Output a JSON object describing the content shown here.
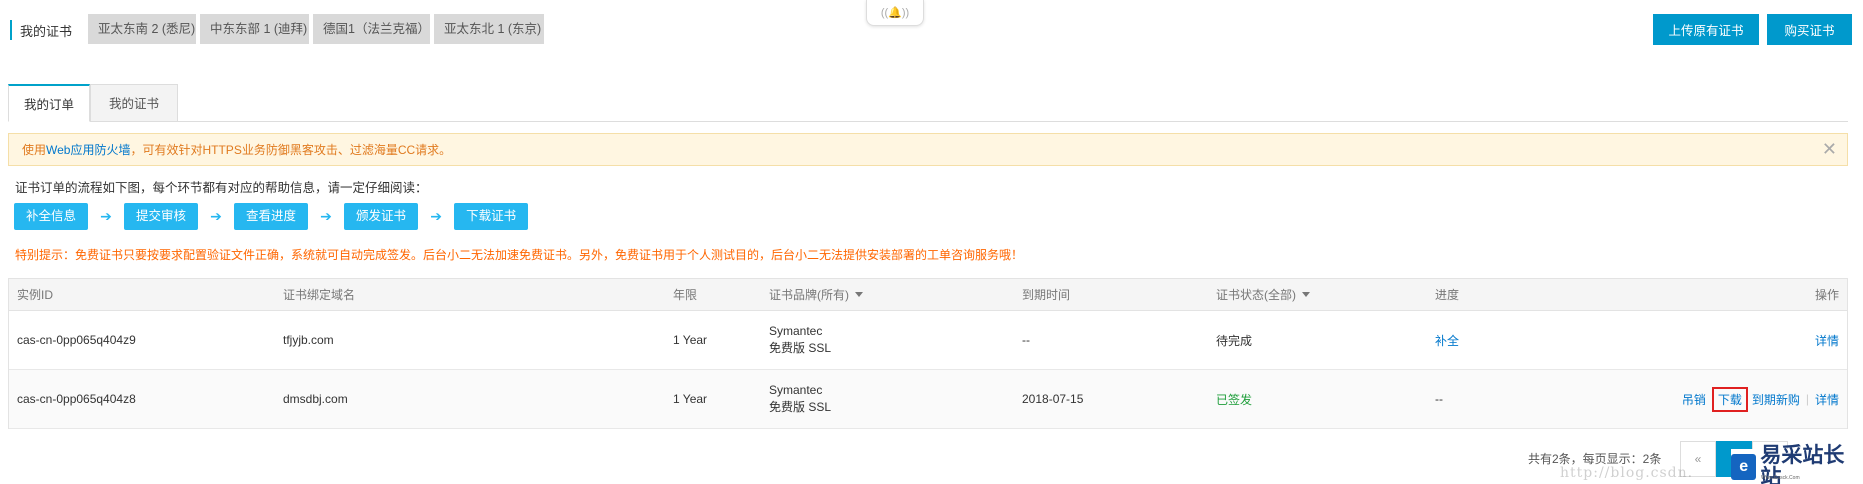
{
  "header": {
    "title": "我的证书",
    "regions": [
      "亚太东南 2 (悉尼)",
      "中东东部 1 (迪拜)",
      "德国1（法兰克福）",
      "亚太东北 1 (东京)"
    ],
    "notif_icon": "((🔔))",
    "upload_btn": "上传原有证书",
    "buy_btn": "购买证书"
  },
  "subtabs": [
    "我的订单",
    "我的证书"
  ],
  "alert": {
    "pre": "使用",
    "link": "Web应用防火墙",
    "post": "，可有效针对HTTPS业务防御黑客攻击、过滤海量CC请求。",
    "close": "✕"
  },
  "flow": {
    "desc": "证书订单的流程如下图，每个环节都有对应的帮助信息，请一定仔细阅读：",
    "steps": [
      "补全信息",
      "提交审核",
      "查看进度",
      "颁发证书",
      "下载证书"
    ],
    "arrow": "➔"
  },
  "tip": "特别提示：免费证书只要按要求配置验证文件正确，系统就可自动完成签发。后台小二无法加速免费证书。另外，免费证书用于个人测试目的，后台小二无法提供安装部署的工单咨询服务哦！",
  "table": {
    "headers": {
      "id": "实例ID",
      "domain": "证书绑定域名",
      "year": "年限",
      "brand": "证书品牌(所有)",
      "expire": "到期时间",
      "status": "证书状态(全部)",
      "progress": "进度",
      "ops": "操作"
    },
    "rows": [
      {
        "id": "cas-cn-0pp065q404z9",
        "domain": "tfjyjb.com",
        "year": "1 Year",
        "brand1": "Symantec",
        "brand2": "免费版 SSL",
        "expire": "--",
        "status": "待完成",
        "progress": "补全",
        "op_detail": "详情"
      },
      {
        "id": "cas-cn-0pp065q404z8",
        "domain": "dmsdbj.com",
        "year": "1 Year",
        "brand1": "Symantec",
        "brand2": "免费版 SSL",
        "expire": "2018-07-15",
        "status": "已签发",
        "progress": "--",
        "op_revoke": "吊销",
        "op_download": "下载",
        "op_renew": "到期新购",
        "op_sep": "|",
        "op_detail": "详情"
      }
    ]
  },
  "pager": {
    "summary": "共有2条，每页显示：2条",
    "prev": "«"
  },
  "watermark": "http://blog.csdn.",
  "logo": {
    "mark": "e",
    "text": "易采站长站",
    "sub": "Www.Easck.Com"
  },
  "colors": {
    "primary": "#0099cc",
    "step": "#26b7f0",
    "warning": "#ff6600",
    "success": "#1e9e3a"
  }
}
